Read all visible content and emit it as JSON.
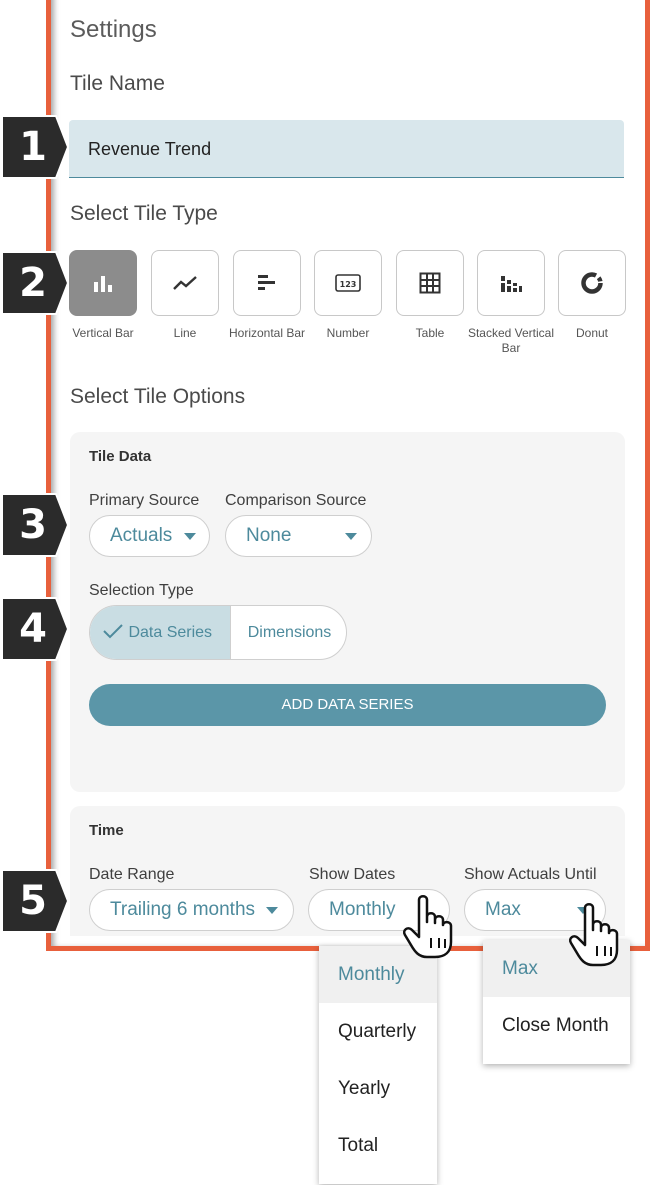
{
  "settings": {
    "title": "Settings",
    "tile_name_heading": "Tile Name",
    "tile_name_value": "Revenue Trend",
    "tile_type_heading": "Select Tile Type",
    "tile_options_heading": "Select Tile Options"
  },
  "badges": [
    "1",
    "2",
    "3",
    "4",
    "5"
  ],
  "tile_types": [
    {
      "label": "Vertical Bar",
      "icon": "vertical-bar-icon",
      "selected": true
    },
    {
      "label": "Line",
      "icon": "line-chart-icon",
      "selected": false
    },
    {
      "label": "Horizontal Bar",
      "icon": "horizontal-bar-icon",
      "selected": false
    },
    {
      "label": "Number",
      "icon": "number-icon",
      "selected": false
    },
    {
      "label": "Table",
      "icon": "table-icon",
      "selected": false
    },
    {
      "label": "Stacked Vertical Bar",
      "icon": "stacked-bar-icon",
      "selected": false
    },
    {
      "label": "Donut",
      "icon": "donut-icon",
      "selected": false
    }
  ],
  "tile_data": {
    "title": "Tile Data",
    "primary_source_label": "Primary Source",
    "primary_source_value": "Actuals",
    "comparison_source_label": "Comparison Source",
    "comparison_source_value": "None",
    "selection_type_label": "Selection Type",
    "selection_type_options": [
      "Data Series",
      "Dimensions"
    ],
    "selection_type_selected": "Data Series",
    "add_button": "ADD DATA SERIES"
  },
  "time": {
    "title": "Time",
    "date_range_label": "Date Range",
    "date_range_value": "Trailing 6 months",
    "show_dates_label": "Show Dates",
    "show_dates_value": "Monthly",
    "show_actuals_label": "Show Actuals Until",
    "show_actuals_value": "Max"
  },
  "show_dates_menu": {
    "options": [
      "Monthly",
      "Quarterly",
      "Yearly",
      "Total"
    ],
    "selected": "Monthly"
  },
  "show_actuals_menu": {
    "options": [
      "Max",
      "Close Month"
    ],
    "selected": "Max"
  },
  "colors": {
    "frame": "#e8603c",
    "accent": "#4d8a9c",
    "button": "#5b96a8",
    "input_bg": "#d9e7ec",
    "badge": "#2b2b2b"
  }
}
